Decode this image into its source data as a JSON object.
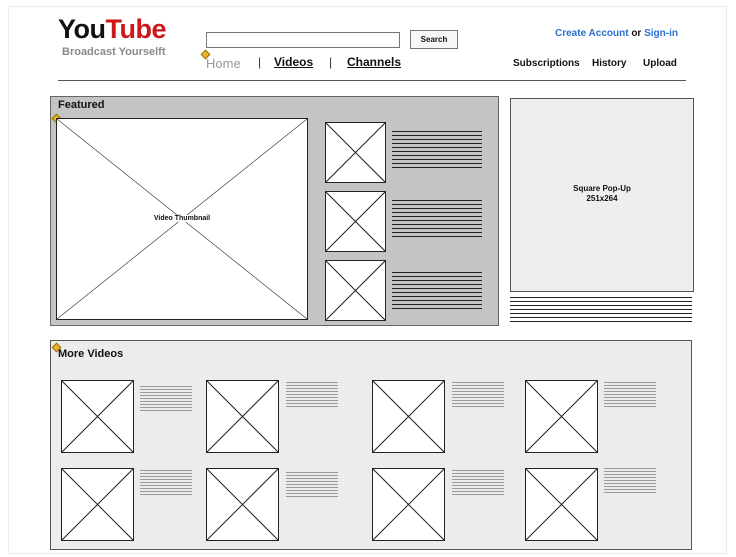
{
  "header": {
    "logo_you": "You",
    "logo_tube": "Tube",
    "tagline": "Broadcast Yourselft",
    "search": {
      "button": "Search",
      "value": "",
      "placeholder": ""
    },
    "nav": {
      "home": "Home",
      "sep1": "|",
      "videos": "Videos",
      "sep2": "|",
      "channels": "Channels"
    },
    "auth": {
      "create": "Create Account",
      "or": "or",
      "signin": "Sign-in"
    },
    "userlinks": {
      "subscriptions": "Subscriptions",
      "history": "History",
      "upload": "Upload"
    }
  },
  "featured": {
    "title": "Featured",
    "thumbnail_label": "Video Thumbnail"
  },
  "popup": {
    "line1": "Square Pop-Up",
    "line2": "251x264"
  },
  "more": {
    "title": "More Videos"
  },
  "colors": {
    "logo_red": "#cc1818",
    "link_blue": "#2a6fcf",
    "featured_bg": "#c4c4c4",
    "panel_bg": "#ececec"
  },
  "icons": [
    "pencil-icon",
    "placeholder-x-icon"
  ]
}
